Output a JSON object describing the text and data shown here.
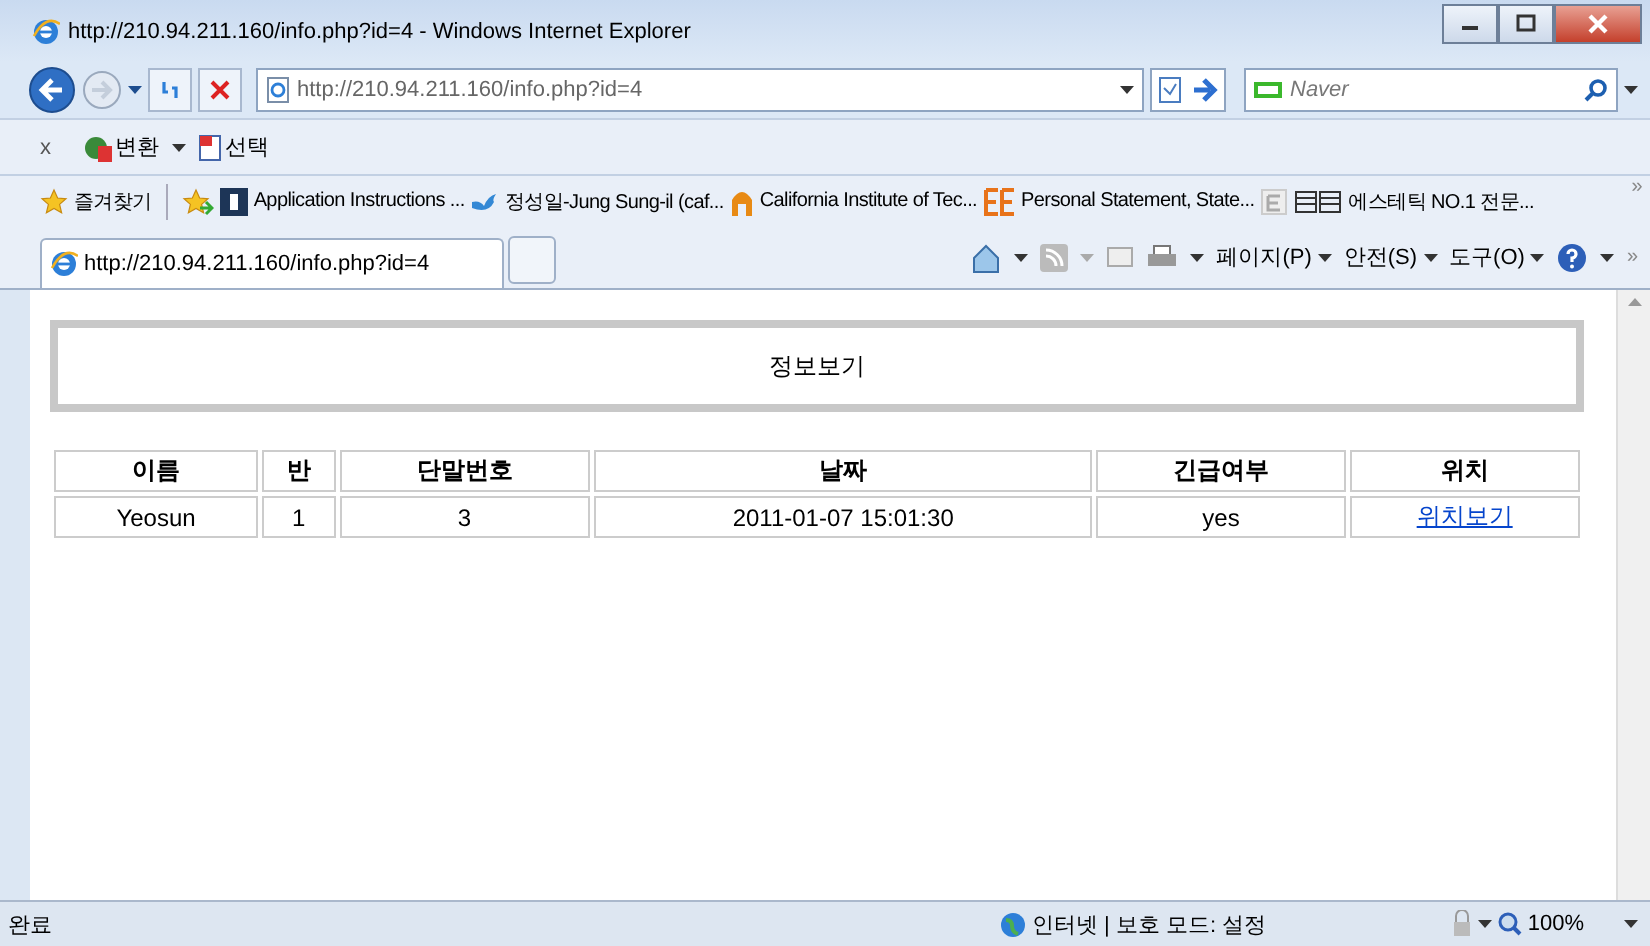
{
  "window": {
    "title": "http://210.94.211.160/info.php?id=4 - Windows Internet Explorer"
  },
  "address_bar": {
    "value": "http://210.94.211.160/info.php?id=4"
  },
  "search": {
    "placeholder": "Naver"
  },
  "command_bar": {
    "close": "x",
    "items": [
      {
        "label": "변환"
      },
      {
        "label": "선택"
      }
    ]
  },
  "favorites": {
    "label": "즐겨찾기",
    "more": "»",
    "items": [
      {
        "label": "Application Instructions  ..."
      },
      {
        "label": "정성일-Jung Sung-il (caf..."
      },
      {
        "label": "California Institute of Tec..."
      },
      {
        "label": "Personal Statement, State..."
      },
      {
        "label": "에스테틱 NO.1 전문..."
      }
    ]
  },
  "tabs": [
    {
      "label": "http://210.94.211.160/info.php?id=4",
      "selected": true
    }
  ],
  "toolbar": {
    "menus": [
      "페이지(P)",
      "안전(S)",
      "도구(O)"
    ],
    "more": "»"
  },
  "page": {
    "heading": "정보보기",
    "table": {
      "columns": [
        "이름",
        "반",
        "단말번호",
        "날짜",
        "긴급여부",
        "위치"
      ],
      "rows": [
        {
          "cells": [
            "Yeosun",
            "1",
            "3",
            "2011-01-07 15:01:30",
            "yes"
          ],
          "link": "위치보기"
        }
      ]
    }
  },
  "status_bar": {
    "text": "완료",
    "zone": "인터넷 | 보호 모드: 설정",
    "zoom": "100%"
  }
}
